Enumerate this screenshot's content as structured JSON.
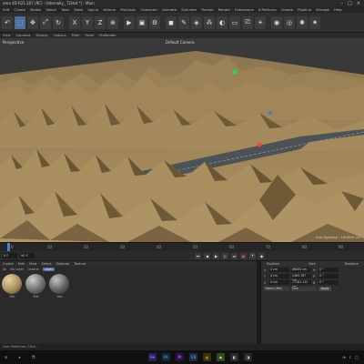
{
  "app": {
    "title": "ema 4D R21.207 (RC) - [eternally_ 72ds4 *] - Main"
  },
  "menubar": [
    "Edit",
    "Create",
    "Modes",
    "Select",
    "Tools",
    "Mesh",
    "Spline",
    "Volume",
    "MoGraph",
    "Character",
    "Animate",
    "Simulate",
    "Tracker",
    "Render",
    "Extensions",
    "X-Particles",
    "Octane",
    "Pipeline",
    "Window",
    "Help"
  ],
  "viewport_menu": [
    "View",
    "Cameras",
    "Display",
    "Options",
    "Filter",
    "Panel",
    "ProRender"
  ],
  "viewport": {
    "label": "Perspective",
    "camera": "Default Camera",
    "grid_spacing": "Grid Spacing : 100000 cm"
  },
  "timeline": {
    "ticks": [
      "0",
      "10",
      "20",
      "30",
      "40",
      "50",
      "60",
      "70",
      "80",
      "90"
    ]
  },
  "transport": {
    "start": "0 F",
    "end": "90 F"
  },
  "material_panel": {
    "menu": [
      "Create",
      "Edit",
      "View",
      "Select",
      "Material",
      "Texture"
    ],
    "filters": [
      "All",
      "No Layer",
      "Octane",
      "Layer"
    ],
    "active_filter": "Layer",
    "materials": [
      {
        "name": "Mat",
        "base": "#a88e5f",
        "highlight": "#e6d3a4"
      },
      {
        "name": "Mat",
        "base": "#6e6e6e",
        "highlight": "#cfcfcf"
      },
      {
        "name": "Mat",
        "base": "#5f5f5f",
        "highlight": "#c4c4c4"
      }
    ]
  },
  "attributes": {
    "header_left": "Position",
    "header_mid": "Size",
    "header_right": "Rotation",
    "rows": [
      {
        "k": "X",
        "v1": "0 cm",
        "v2": "86000 cm",
        "k3": "H",
        "v3": "0 °"
      },
      {
        "k": "Y",
        "v1": "0 cm",
        "v2": "2465.787 cm",
        "k3": "P",
        "v3": "0 °"
      },
      {
        "k": "Z",
        "v1": "0 cm",
        "v2": "77181.112 cm",
        "k3": "B",
        "v3": "0 °"
      }
    ],
    "object_dropdown": "Object (Rel)",
    "size_dropdown": "Size",
    "apply": "Apply"
  },
  "status": "Live Selection: Click...",
  "colors": {
    "terrain": "#a48a5c",
    "terrain_shadow": "#5e4c30",
    "road": "#4d5257",
    "accent": "#4d6f9c"
  }
}
